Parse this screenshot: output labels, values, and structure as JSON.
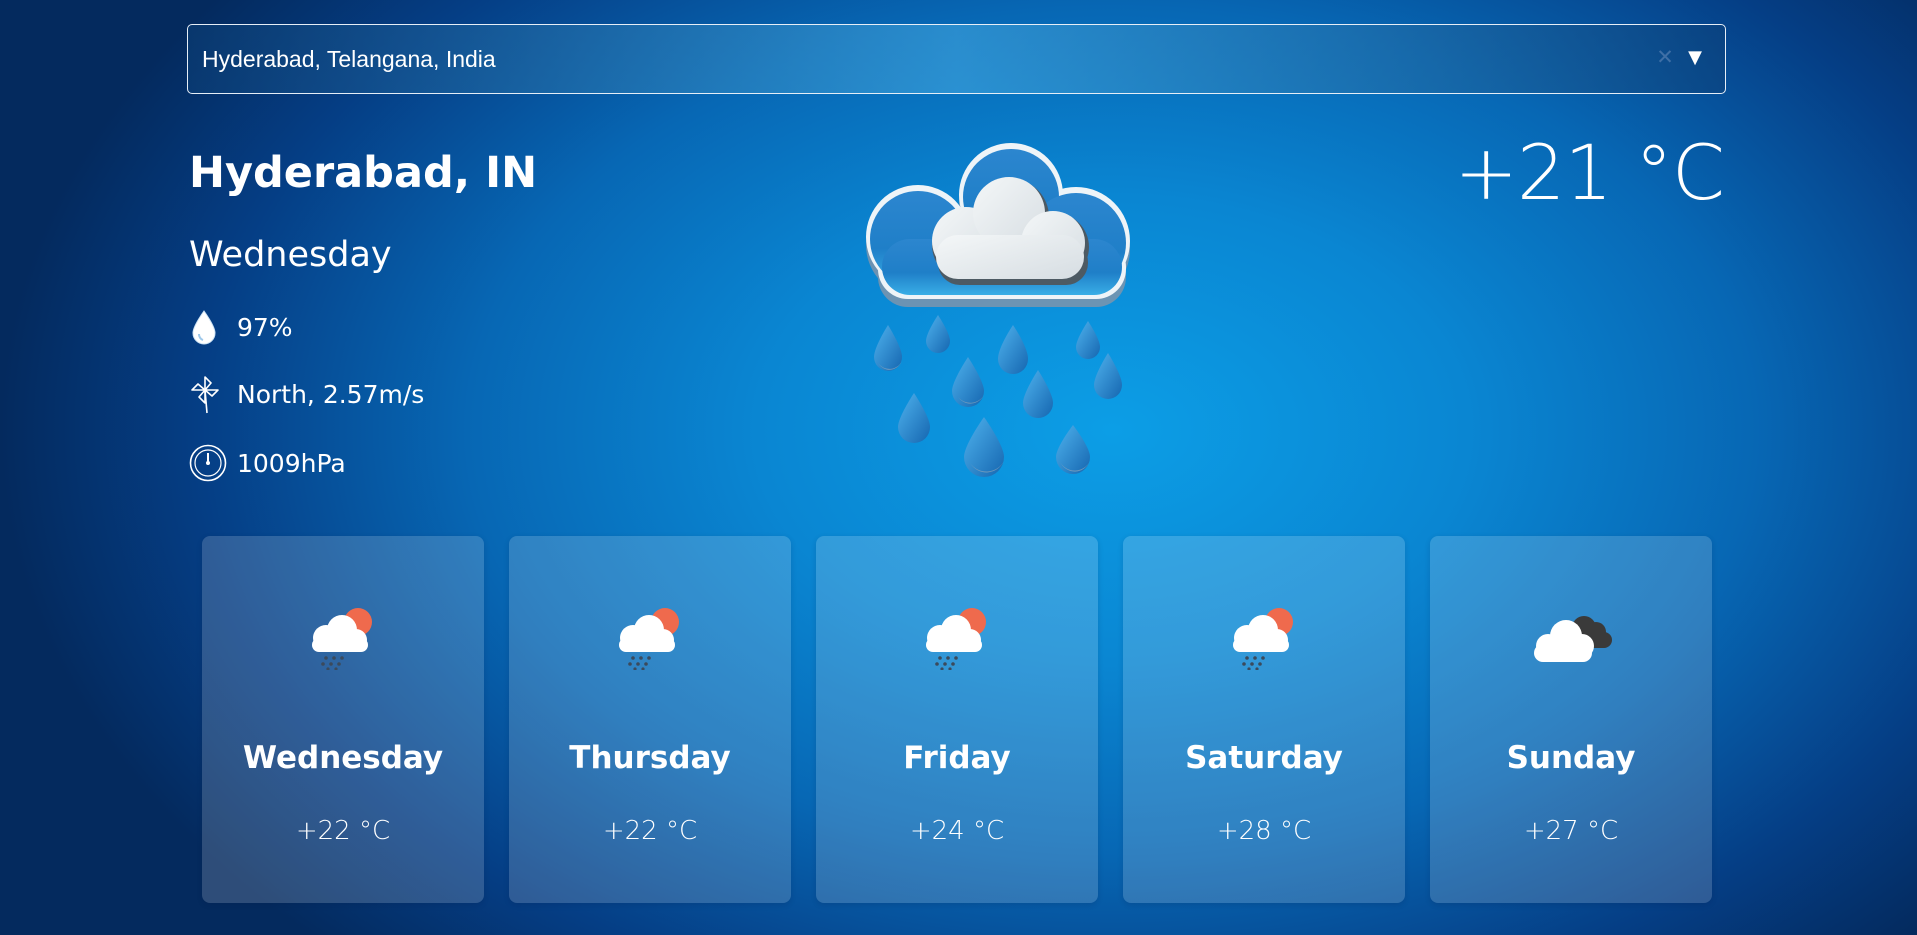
{
  "search": {
    "value": "Hyderabad, Telangana, India",
    "clear_icon": "close-icon",
    "dropdown_icon": "chevron-down-icon"
  },
  "current": {
    "location": "Hyderabad, IN",
    "day": "Wednesday",
    "temperature": "+21 °C",
    "condition_icon": "rain-cloud-icon",
    "humidity": "97%",
    "wind": "North, 2.57m/s",
    "pressure": "1009hPa"
  },
  "icons": {
    "humidity": "droplet-icon",
    "wind": "pinwheel-icon",
    "pressure": "gauge-icon"
  },
  "forecast": [
    {
      "day": "Wednesday",
      "temp": "+22 °C",
      "icon": "sun-cloud-rain-icon"
    },
    {
      "day": "Thursday",
      "temp": "+22 °C",
      "icon": "sun-cloud-rain-icon"
    },
    {
      "day": "Friday",
      "temp": "+24 °C",
      "icon": "sun-cloud-rain-icon"
    },
    {
      "day": "Saturday",
      "temp": "+28 °C",
      "icon": "sun-cloud-rain-icon"
    },
    {
      "day": "Sunday",
      "temp": "+27 °C",
      "icon": "broken-clouds-icon"
    }
  ],
  "colors": {
    "background_center": "#0c9ee6",
    "background_edge": "#042a5e",
    "sun": "#ef6a4d",
    "rain_drop": "#2286cc",
    "dark_cloud": "#3a3a3a"
  }
}
